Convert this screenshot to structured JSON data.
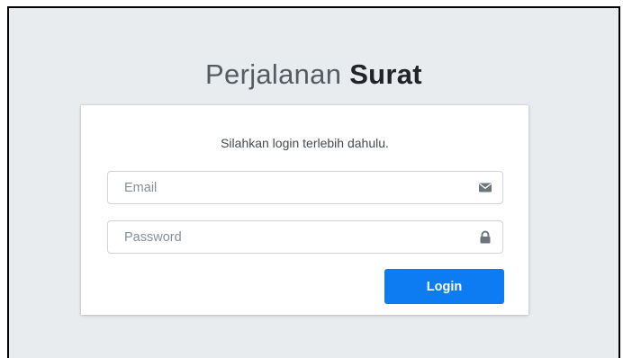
{
  "logo": {
    "light": "Perjalanan ",
    "bold": "Surat"
  },
  "login_box": {
    "message": "Silahkan login terlebih dahulu.",
    "email": {
      "placeholder": "Email",
      "value": "",
      "icon": "envelope-icon"
    },
    "password": {
      "placeholder": "Password",
      "value": "",
      "icon": "lock-icon"
    },
    "submit_label": "Login"
  },
  "colors": {
    "page_background": "#e9ecef",
    "primary_button": "#0d7bf2",
    "icon": "#6c757d"
  }
}
